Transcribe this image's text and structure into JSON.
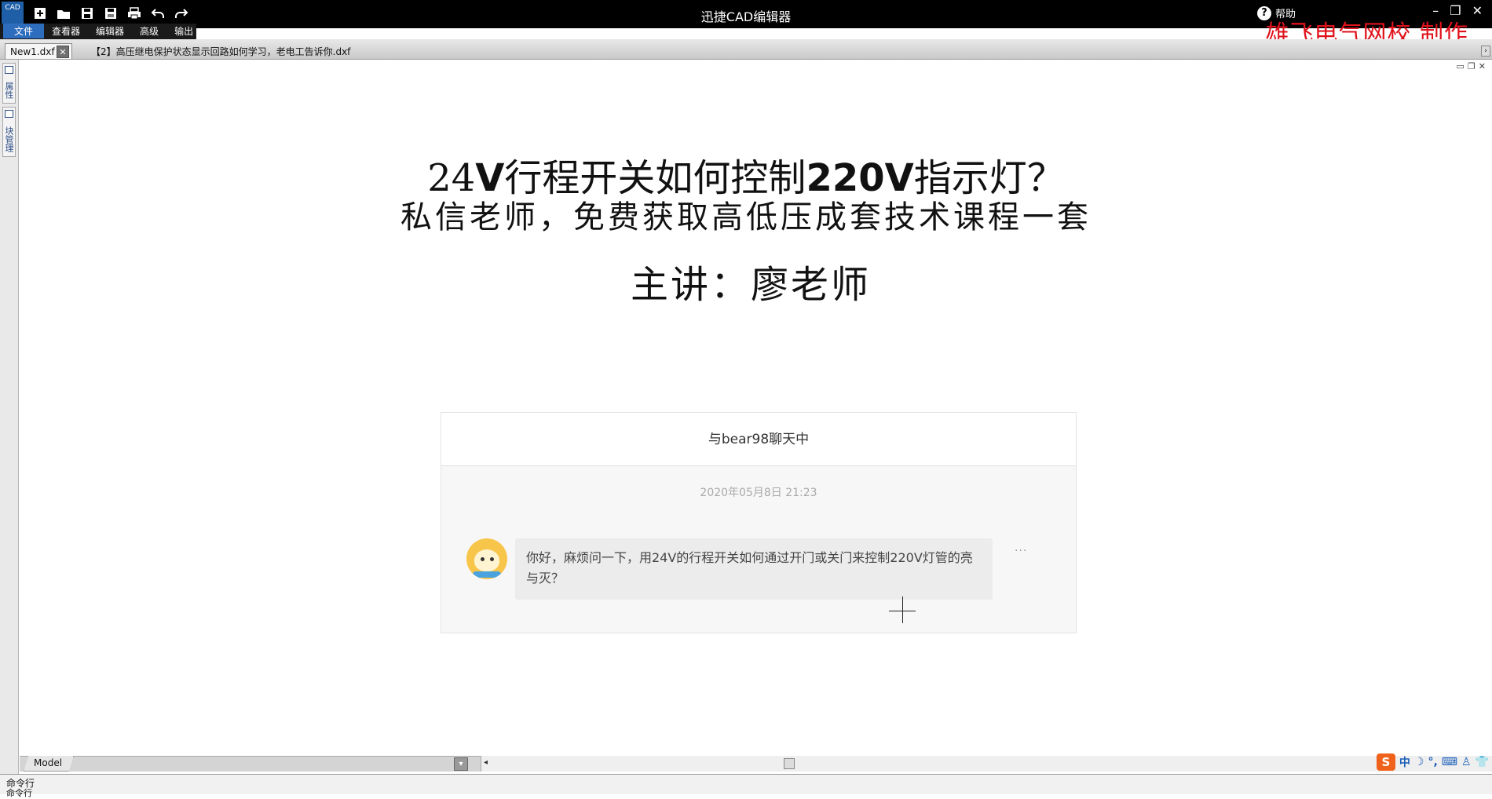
{
  "titlebar": {
    "app_logo": "CAD",
    "window_title": "迅捷CAD编辑器",
    "help_label": "帮助",
    "help_icon_glyph": "?",
    "watermark": "雄飞电气网校  制作"
  },
  "quick_tools": [
    {
      "icon": "new-icon"
    },
    {
      "icon": "open-folder-icon"
    },
    {
      "icon": "save-icon"
    },
    {
      "icon": "save-as-icon"
    },
    {
      "icon": "print-icon"
    },
    {
      "icon": "undo-icon"
    },
    {
      "icon": "redo-icon"
    }
  ],
  "menu": {
    "file": "文件",
    "items": [
      "查看器",
      "编辑器",
      "高级",
      "输出"
    ]
  },
  "tabs": {
    "active": "New1.dxf",
    "close_glyph": "✕",
    "second": "【2】高压继电保护状态显示回路如何学习，老电工告诉你.dxf"
  },
  "side_tabs": [
    "属性",
    "块管理"
  ],
  "slide": {
    "line1_a": "24",
    "line1_b": "V",
    "line1_c": "行程开关如何控制",
    "line1_d": "220V",
    "line1_e": "指示灯？",
    "line2": "私信老师，免费获取高低压成套技术课程一套",
    "line3": "主讲：廖老师"
  },
  "chat": {
    "header": "与bear98聊天中",
    "time": "2020年05月8日 21:23",
    "message": "你好，麻烦问一下，用24V的行程开关如何通过开门或关门来控制220V灯管的亮与灭？",
    "more": "···"
  },
  "bottom": {
    "model_tab": "Model",
    "scroll_left": "◂",
    "dropdown_glyph": "▾"
  },
  "ime": {
    "logo": "S",
    "items": [
      "中",
      "☽",
      "°,",
      "⌨",
      "♙",
      "👕"
    ]
  },
  "command": {
    "label": "命令行",
    "label2": "命令行"
  },
  "colors": {
    "watermark": "#e0121b",
    "menu_file_bg": "#2e6dbd",
    "titlebar_bg": "#000000"
  }
}
